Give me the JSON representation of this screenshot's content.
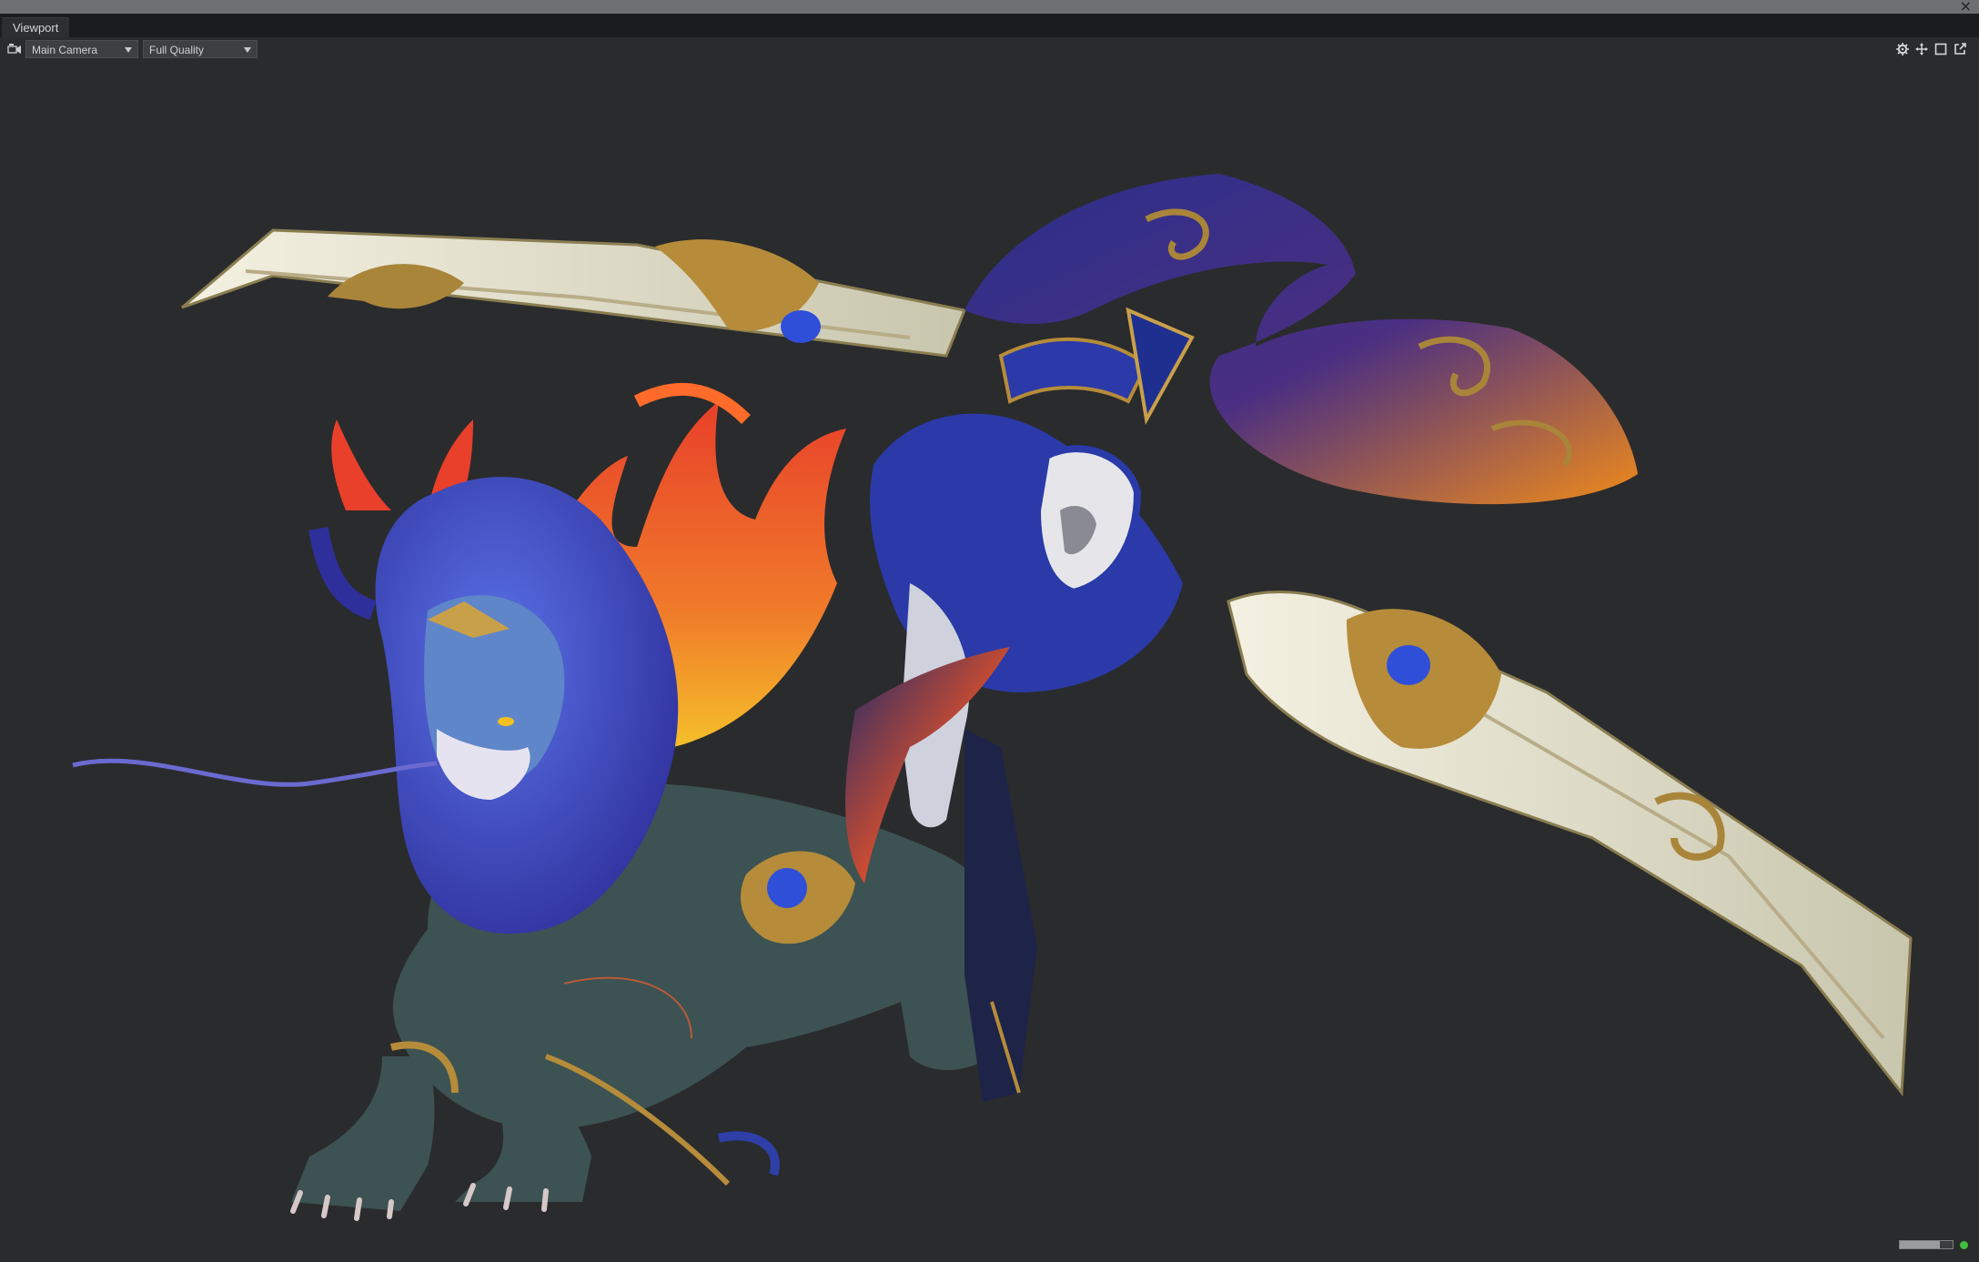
{
  "window": {
    "close_glyph": "×",
    "tab_label": "Viewport"
  },
  "toolbar": {
    "camera_icon": "camera-icon",
    "camera_select": "Main Camera",
    "quality_select": "Full Quality",
    "right_icons": [
      "gear-icon",
      "move-icon",
      "maximize-icon",
      "popout-icon"
    ]
  },
  "viewport": {
    "background": "#2a2b2d",
    "subject": "3D character model: armored rider on blue-maned lion with orange flame fur, wielding two giant ornate blades"
  },
  "status": {
    "progress": 0.75,
    "indicator_color": "#3fbf3f"
  }
}
